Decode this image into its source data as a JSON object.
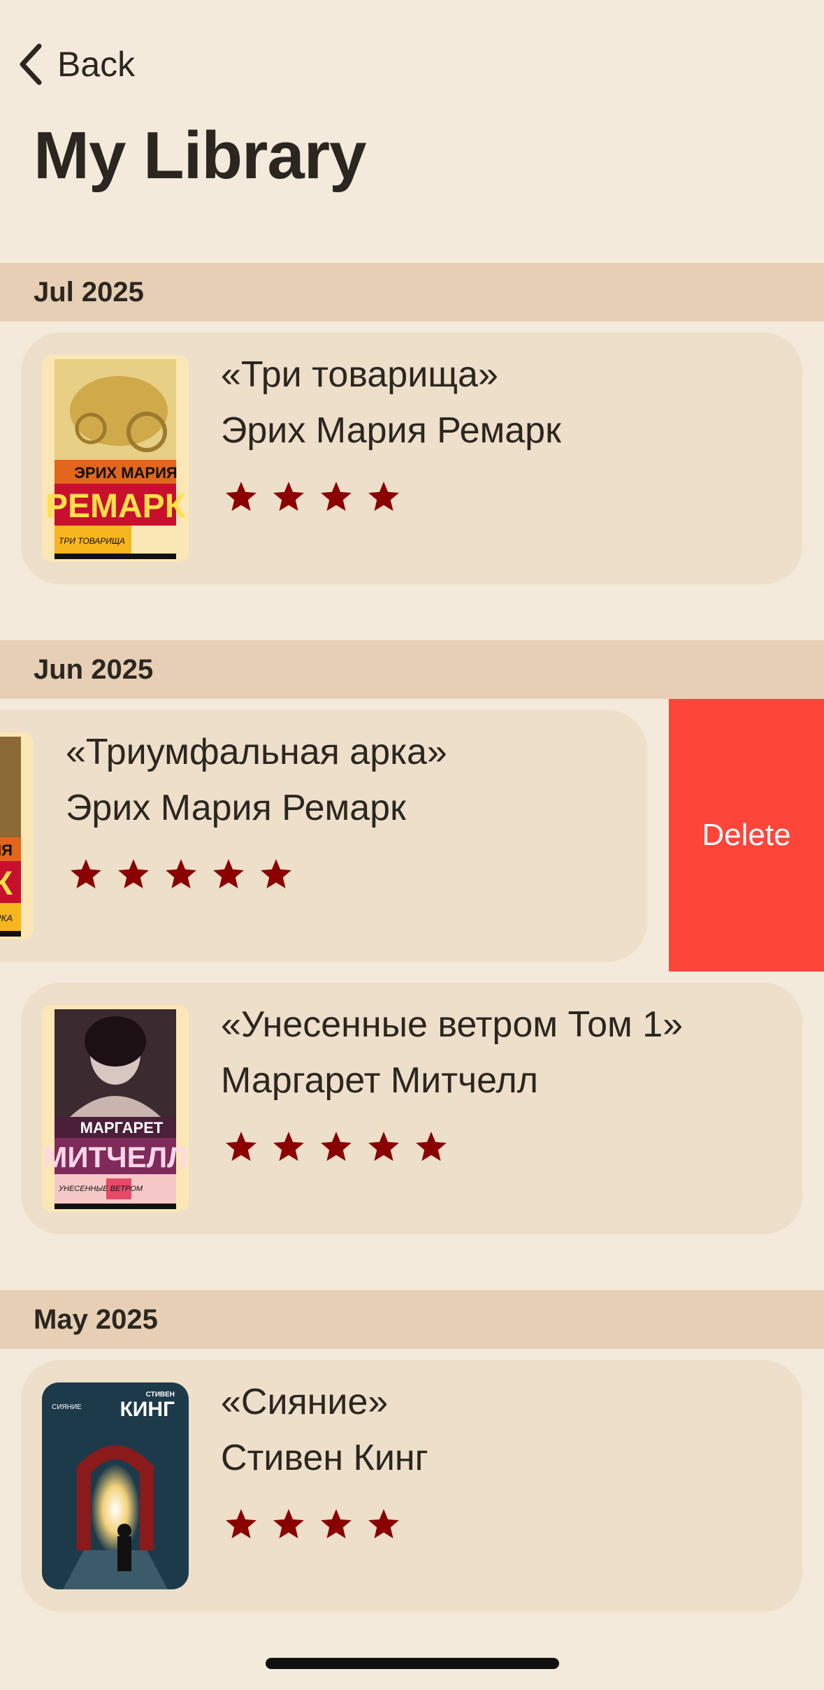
{
  "nav": {
    "back_label": "Back",
    "title": "My Library"
  },
  "sections": [
    {
      "label": "Jul 2025"
    },
    {
      "label": "Jun 2025"
    },
    {
      "label": "May 2025"
    }
  ],
  "books": [
    {
      "title": "«Три товарища»",
      "author": "Эрих Мария Ремарк",
      "rating": 4,
      "cover": {
        "author_line1": "ЭРИХ МАРИЯ",
        "author_line2": "РЕМАРК",
        "title": "ТРИ ТОВАРИЩА"
      }
    },
    {
      "title": "«Триумфальная арка»",
      "author": "Эрих Мария Ремарк",
      "rating": 5,
      "cover": {
        "author_line1": "РИЯ",
        "author_line2": "К",
        "title": "ЛЬНАЯ АРКА"
      }
    },
    {
      "title": "«Унесенные ветром Том 1»",
      "author": "Маргарет Митчелл",
      "rating": 5,
      "cover": {
        "author_line1": "МАРГАРЕТ",
        "author_line2": "МИТЧЕЛЛ",
        "title": "УНЕСЕННЫЕ ВЕТРОМ"
      }
    },
    {
      "title": "«Сияние»",
      "author": "Стивен Кинг",
      "rating": 4,
      "cover": {
        "author_line1": "СТИВЕН",
        "author_line2": "КИНГ",
        "title": "СИЯНИЕ"
      }
    }
  ],
  "actions": {
    "delete_label": "Delete"
  },
  "colors": {
    "background": "#f4eadb",
    "section_header": "#e6cfb4",
    "card": "#eddfc9",
    "star": "#8b0000",
    "delete": "#fd453a"
  }
}
